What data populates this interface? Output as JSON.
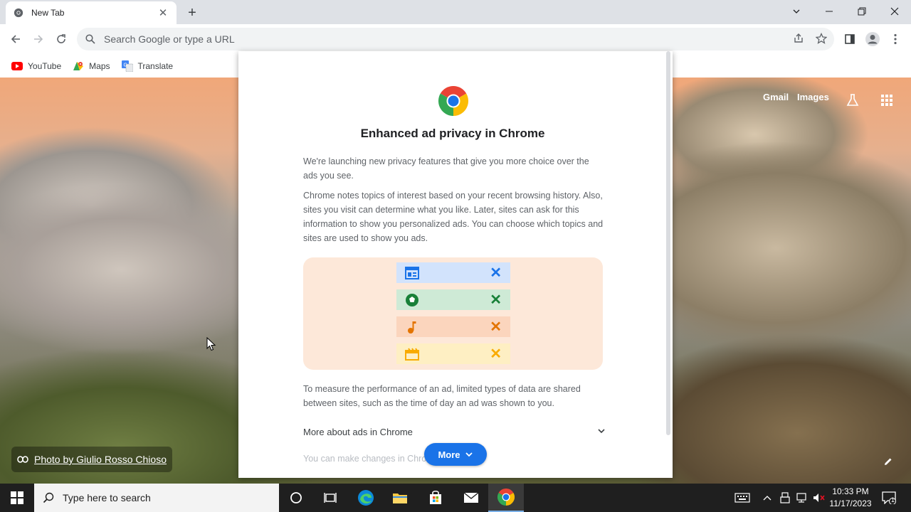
{
  "browser": {
    "tab": {
      "title": "New Tab",
      "close": "✕"
    },
    "new_tab": "+",
    "omnibox": {
      "placeholder": "Search Google or type a URL"
    },
    "bookmarks": [
      {
        "label": "YouTube",
        "icon": "youtube-icon"
      },
      {
        "label": "Maps",
        "icon": "maps-icon"
      },
      {
        "label": "Translate",
        "icon": "translate-icon"
      }
    ]
  },
  "ntp": {
    "gmail": "Gmail",
    "images": "Images",
    "photo_credit": "Photo by Giulio Rosso Chioso"
  },
  "dialog": {
    "title": "Enhanced ad privacy in Chrome",
    "para1": "We're launching new privacy features that give you more choice over the ads you see.",
    "para2": "Chrome notes topics of interest based on your recent browsing history. Also, sites you visit can determine what you like. Later, sites can ask for this information to show you personalized ads. You can choose which topics and sites are used to show you ads.",
    "para3": "To measure the performance of an ad, limited types of data are shared between sites, such as the time of day an ad was shown to you.",
    "expand_label": "More about ads in Chrome",
    "fade_text": "You can make changes in Chrome settings",
    "more_button": "More",
    "illustration_rows": [
      {
        "icon": "browser-window-icon",
        "bg": "#d2e3fc",
        "color": "#1a73e8",
        "x": "✕"
      },
      {
        "icon": "soccer-ball-icon",
        "bg": "#ceead6",
        "color": "#188038",
        "x": "✕"
      },
      {
        "icon": "music-note-icon",
        "bg": "#fbd5bd",
        "color": "#e37400",
        "x": "✕"
      },
      {
        "icon": "clapperboard-icon",
        "bg": "#feefc3",
        "color": "#f9ab00",
        "x": "✕"
      }
    ]
  },
  "taskbar": {
    "search_placeholder": "Type here to search",
    "time": "10:33 PM",
    "date": "11/17/2023",
    "notification_count": "1"
  }
}
